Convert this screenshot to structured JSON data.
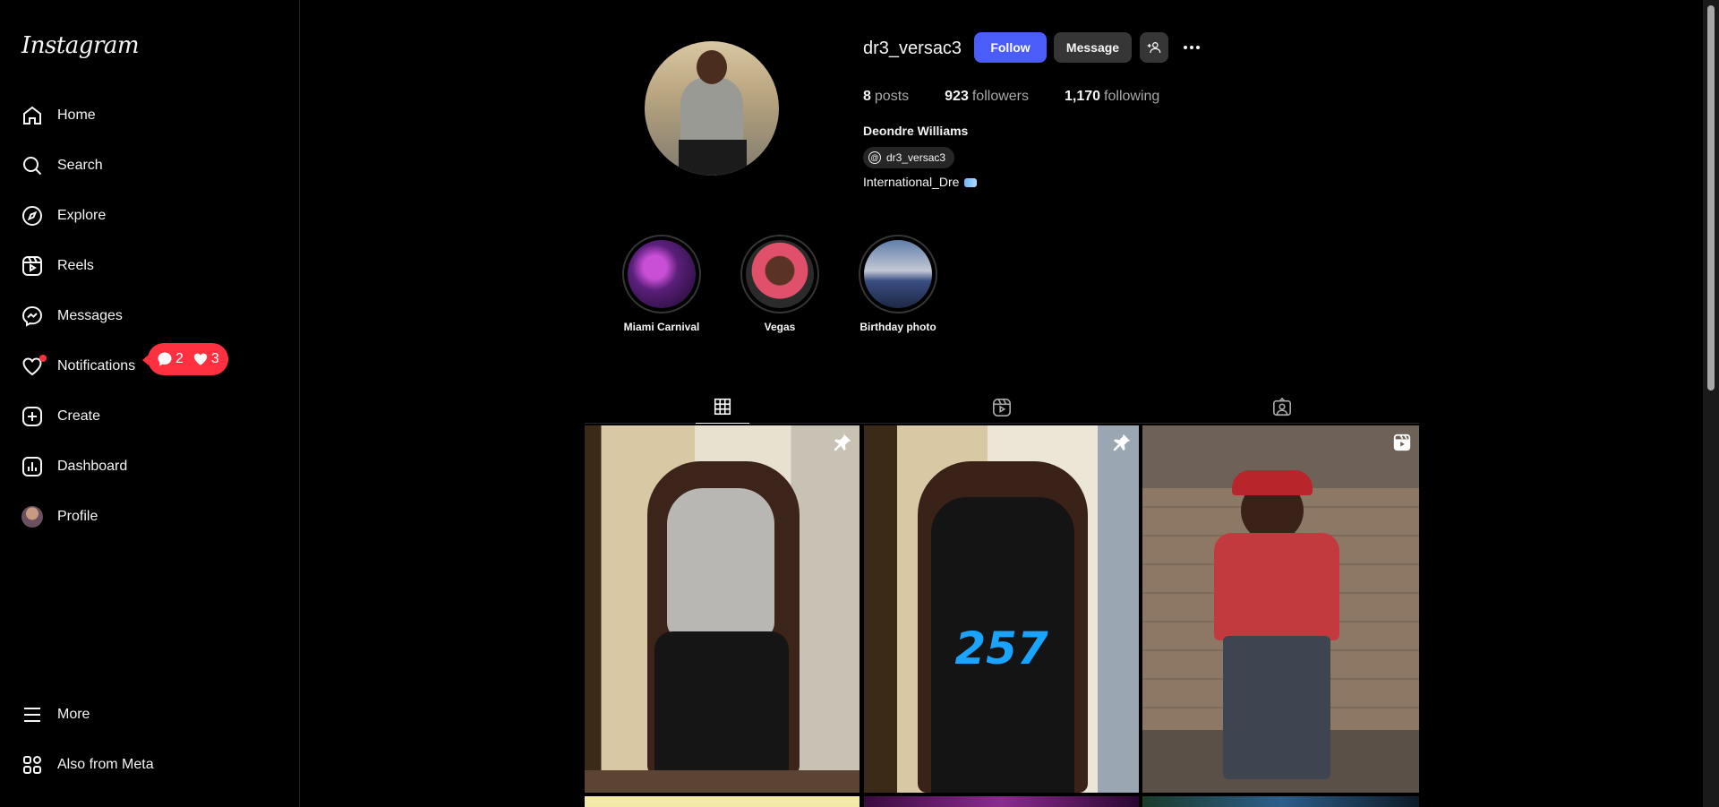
{
  "app": {
    "logo_text": "Instagram"
  },
  "sidebar": {
    "items": [
      {
        "label": "Home",
        "icon": "home-icon"
      },
      {
        "label": "Search",
        "icon": "search-icon"
      },
      {
        "label": "Explore",
        "icon": "compass-icon"
      },
      {
        "label": "Reels",
        "icon": "reels-icon"
      },
      {
        "label": "Messages",
        "icon": "messenger-icon"
      },
      {
        "label": "Notifications",
        "icon": "heart-icon"
      },
      {
        "label": "Create",
        "icon": "plus-square-icon"
      },
      {
        "label": "Dashboard",
        "icon": "chart-icon"
      },
      {
        "label": "Profile",
        "icon": "avatar-icon"
      }
    ],
    "bottom": [
      {
        "label": "More",
        "icon": "menu-icon"
      },
      {
        "label": "Also from Meta",
        "icon": "meta-grid-icon"
      }
    ],
    "notification_pill": {
      "comments": "2",
      "likes": "3"
    }
  },
  "profile": {
    "username": "dr3_versac3",
    "follow_label": "Follow",
    "message_label": "Message",
    "stats": {
      "posts": "8",
      "posts_label": "posts",
      "followers": "923",
      "followers_label": "followers",
      "following": "1,170",
      "following_label": "following"
    },
    "full_name": "Deondre Williams",
    "threads_handle": "dr3_versac3",
    "bio": "International_Dre"
  },
  "highlights": [
    {
      "label": "Miami Carnival"
    },
    {
      "label": "Vegas"
    },
    {
      "label": "Birthday photo"
    }
  ],
  "tabs": [
    {
      "name": "posts",
      "icon": "grid-icon",
      "active": true
    },
    {
      "name": "reels",
      "icon": "reels-icon",
      "active": false
    },
    {
      "name": "tagged",
      "icon": "tagged-icon",
      "active": false
    }
  ],
  "posts": [
    {
      "badge": "pin-icon",
      "overlay": ""
    },
    {
      "badge": "pin-icon",
      "overlay": "257"
    },
    {
      "badge": "reel-icon",
      "overlay": ""
    }
  ],
  "colors": {
    "accent": "#4a5df9",
    "notification": "#ff3040",
    "background": "#000000"
  }
}
